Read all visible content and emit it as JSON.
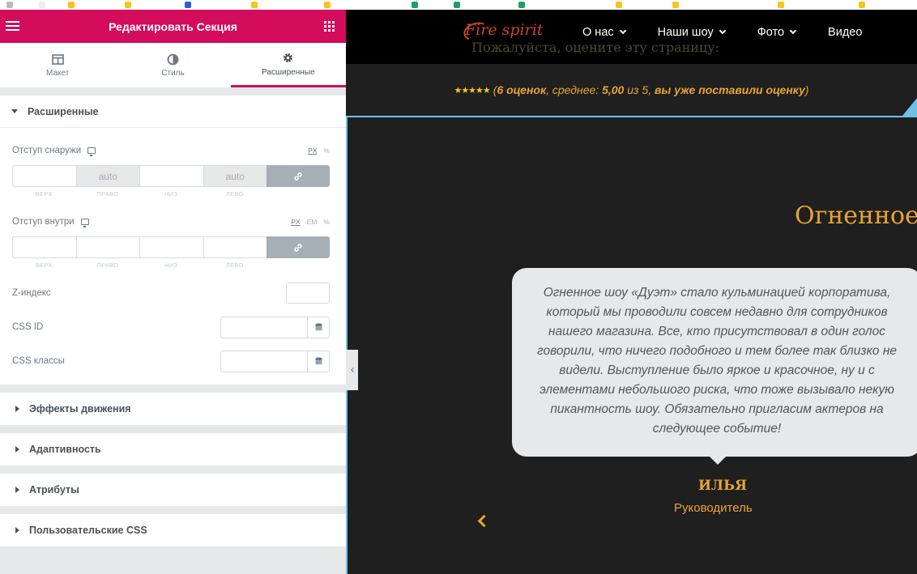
{
  "panel": {
    "title": "Редактировать Секция",
    "tabs": [
      {
        "label": "Макет",
        "icon": "layout-icon"
      },
      {
        "label": "Стиль",
        "icon": "style-icon"
      },
      {
        "label": "Расширенные",
        "icon": "gear-icon",
        "active": true
      }
    ],
    "advanced_section": {
      "title": "Расширенные",
      "margin": {
        "label": "Отступ снаружи",
        "units": [
          "PX",
          "%"
        ],
        "top": "",
        "right": "auto",
        "bottom": "",
        "left": "auto",
        "labels": [
          "ВЕРХ",
          "ПРАВО",
          "НИЗ",
          "ЛЕВО"
        ]
      },
      "padding": {
        "label": "Отступ внутри",
        "units": [
          "PX",
          "EM",
          "%"
        ],
        "top": "",
        "right": "",
        "bottom": "",
        "left": "",
        "labels": [
          "ВЕРХ",
          "ПРАВО",
          "НИЗ",
          "ЛЕВО"
        ]
      },
      "z_index_label": "Z-индекс",
      "css_id_label": "CSS ID",
      "css_classes_label": "CSS классы"
    },
    "collapsed_sections": [
      "Эффекты движения",
      "Адаптивность",
      "Атрибуты",
      "Пользовательские CSS"
    ]
  },
  "site": {
    "ghost_text": "Пожалуйста, оцените эту страницу:",
    "logo_text": "Fire spirit",
    "nav": [
      {
        "label": "О нас",
        "dropdown": true
      },
      {
        "label": "Наши шоу",
        "dropdown": true
      },
      {
        "label": "Фото",
        "dropdown": true
      },
      {
        "label": "Видео",
        "dropdown": false
      }
    ],
    "rating": {
      "stars": "★★★★★",
      "open": "(",
      "count": "6 оценок",
      "sep1": ", среднее: ",
      "avg": "5,00",
      "sep2": " из 5, ",
      "voted": "вы уже поставили оценку",
      "close": ")"
    },
    "heading": "Огненное",
    "testimonial": "Огненное шоу «Дуэт» стало кульминацией корпоратива, который мы проводили совсем недавно для сотрудников нашего магазина. Все, кто присутствовал в один голос говорили, что ничего подобного и тем более так близко не видели. Выступление было яркое и красочное, ну и с элементами небольшого риска, что тоже вызывало некую пикантность шоу. Обязательно пригласим актеров на следующее событие!",
    "author": "ИЛЬЯ",
    "role": "Руководитель"
  },
  "colors": {
    "accent": "#d30c5c",
    "orange": "#e8a533",
    "link_blue": "#6ec1e4"
  }
}
